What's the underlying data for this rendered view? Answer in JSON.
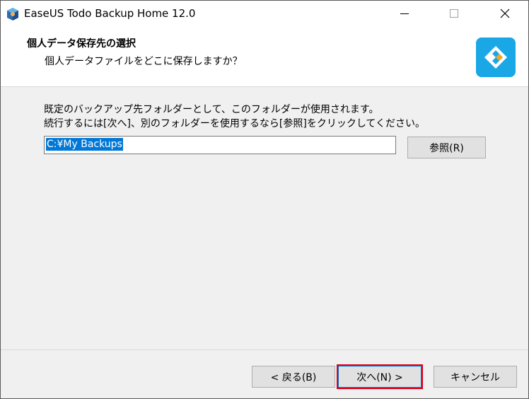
{
  "window": {
    "title": "EaseUS Todo Backup Home 12.0"
  },
  "header": {
    "title": "個人データ保存先の選択",
    "subtitle": "個人データファイルをどこに保存しますか？"
  },
  "content": {
    "description_line1": "既定のバックアップ先フォルダーとして、このフォルダーが使用されます。",
    "description_line2": "続行するには[次へ]、別のフォルダーを使用するなら[参照]をクリックしてください。",
    "path_value": "C:¥My Backups",
    "browse_label": "参照(R)"
  },
  "footer": {
    "back_label": "< 戻る(B)",
    "next_label": "次へ(N) >",
    "cancel_label": "キャンセル"
  },
  "colors": {
    "accent": "#0078d7",
    "highlight": "#e0001a",
    "brand": "#1aa7e6"
  }
}
